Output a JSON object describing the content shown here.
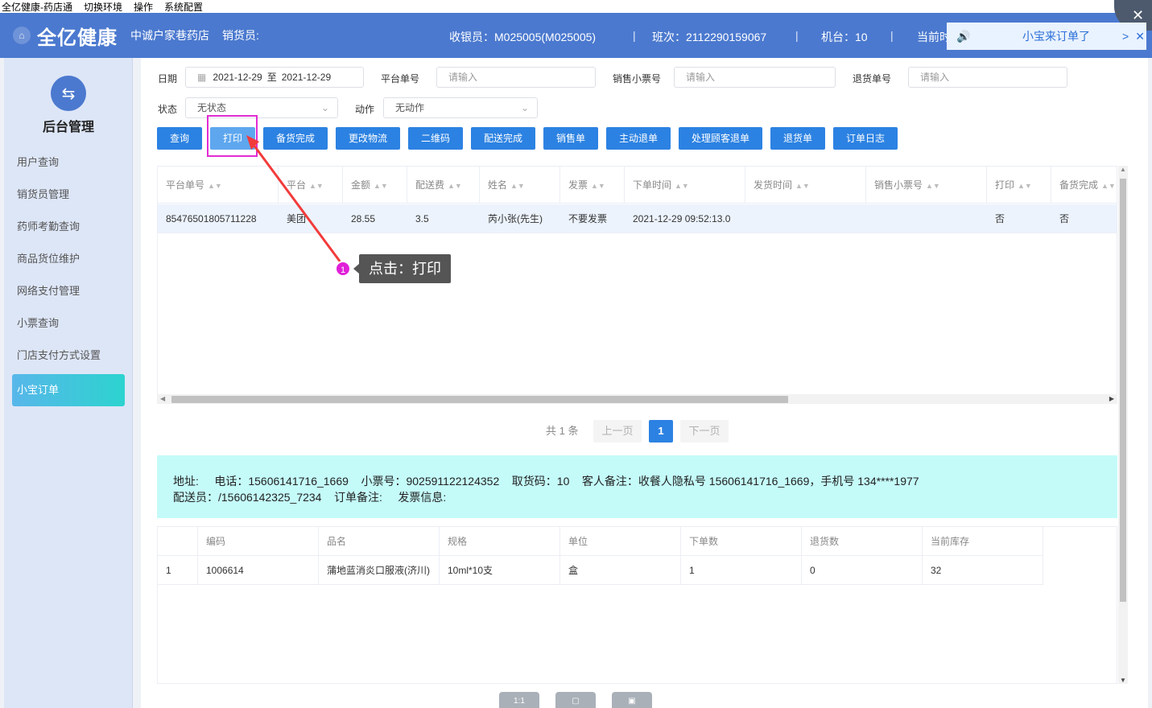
{
  "menubar": [
    "全亿健康-药店通",
    "切换环境",
    "操作",
    "系统配置"
  ],
  "header": {
    "brand": "全亿健康",
    "store": "中诚户家巷药店",
    "seller": "销货员:",
    "cashier": "收银员：M025005(M025005)",
    "shift": "班次：2112290159067",
    "machine": "机台：10",
    "current": "当前时"
  },
  "notification": {
    "text": "小宝来订单了",
    "arrow": ">",
    "close": "✕"
  },
  "window_close": "✕",
  "sidebar": {
    "title": "后台管理",
    "items": [
      {
        "label": "用户查询"
      },
      {
        "label": "销货员管理"
      },
      {
        "label": "药师考勤查询"
      },
      {
        "label": "商品货位维护"
      },
      {
        "label": "网络支付管理"
      },
      {
        "label": "小票查询"
      },
      {
        "label": "门店支付方式设置"
      },
      {
        "label": "小宝订单",
        "active": true
      }
    ]
  },
  "filters": {
    "date_label": "日期",
    "date_from": "2021-12-29",
    "date_sep": "至",
    "date_to": "2021-12-29",
    "platform_no_label": "平台单号",
    "platform_no_placeholder": "请输入",
    "sales_ticket_label": "销售小票号",
    "sales_ticket_placeholder": "请输入",
    "return_no_label": "退货单号",
    "return_no_placeholder": "请输入",
    "status_label": "状态",
    "status_value": "无状态",
    "action_label": "动作",
    "action_value": "无动作"
  },
  "buttons": [
    "查询",
    "打印",
    "备货完成",
    "更改物流",
    "二维码",
    "配送完成",
    "销售单",
    "主动退单",
    "处理顾客退单",
    "退货单",
    "订单日志"
  ],
  "orders": {
    "columns": [
      "平台单号",
      "平台",
      "金额",
      "配送费",
      "姓名",
      "发票",
      "下单时间",
      "发货时间",
      "销售小票号",
      "打印",
      "备货完成"
    ],
    "rows": [
      [
        "85476501805711228",
        "美团",
        "28.55",
        "3.5",
        "芮小张(先生)",
        "不要发票",
        "2021-12-29 09:52:13.0",
        "",
        "",
        "否",
        "否"
      ]
    ]
  },
  "pagination": {
    "total": "共 1 条",
    "prev": "上一页",
    "current": "1",
    "next": "下一页"
  },
  "info": {
    "line1": "地址:     电话：15606141716_1669    小票号：902591122124352    取货码：10    客人备注：收餐人隐私号 15606141716_1669，手机号 134****1977",
    "line2": "配送员：/15606142325_7234    订单备注:     发票信息:"
  },
  "details": {
    "columns": [
      "",
      "编码",
      "品名",
      "规格",
      "单位",
      "下单数",
      "退货数",
      "当前库存"
    ],
    "rows": [
      [
        "1",
        "1006614",
        "蒲地蓝消炎口服液(济川)",
        "10ml*10支",
        "盒",
        "1",
        "0",
        "32"
      ]
    ]
  },
  "annotation": {
    "step": "1",
    "text": "点击：打印"
  },
  "bottom_toolbar": [
    "1:1",
    "",
    ""
  ],
  "colors": {
    "header_bg": "#4b79cf",
    "button": "#2c82e2",
    "highlight": "#e22cd4",
    "active_side": "#2cd3cf",
    "info_bg": "#c4fbf9"
  }
}
